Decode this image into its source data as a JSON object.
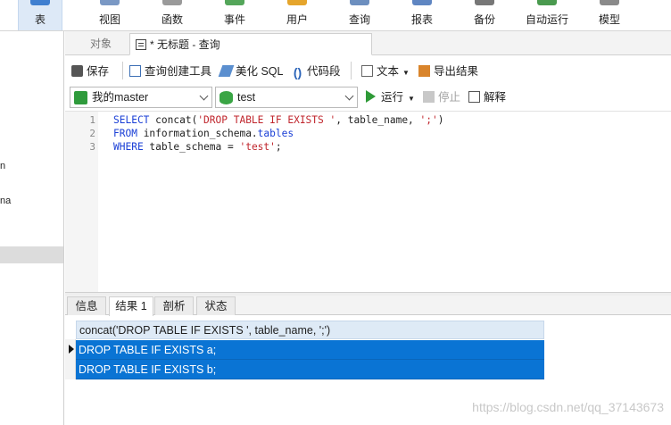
{
  "ribbon": {
    "items": [
      {
        "label": "表",
        "icon": "table-icon",
        "active": true
      },
      {
        "label": "视图",
        "icon": "view-icon"
      },
      {
        "label": "函数",
        "icon": "function-icon"
      },
      {
        "label": "事件",
        "icon": "event-icon"
      },
      {
        "label": "用户",
        "icon": "user-icon"
      },
      {
        "label": "查询",
        "icon": "query-icon"
      },
      {
        "label": "报表",
        "icon": "report-icon"
      },
      {
        "label": "备份",
        "icon": "backup-icon"
      },
      {
        "label": "自动运行",
        "icon": "automation-icon"
      },
      {
        "label": "模型",
        "icon": "model-icon"
      }
    ]
  },
  "leftpane": {
    "frag1": "n",
    "frag2": "na"
  },
  "tabs": {
    "objects": "对象",
    "query": "* 无标题 - 查询"
  },
  "toolbar": {
    "save": "保存",
    "query_builder": "查询创建工具",
    "beautify": "美化 SQL",
    "snippet": "代码段",
    "text": "文本",
    "export": "导出结果"
  },
  "connection": {
    "server": "我的master",
    "database": "test",
    "run": "运行",
    "stop": "停止",
    "explain": "解释"
  },
  "editor": {
    "line_numbers": [
      "1",
      "2",
      "3"
    ],
    "line1": {
      "kw1": "SELECT",
      "t1": " concat(",
      "s1": "'DROP TABLE IF EXISTS '",
      "t2": ", table_name, ",
      "s2": "';'",
      "t3": ")"
    },
    "line2": {
      "kw1": "FROM",
      "t1": " information_schema.",
      "kw2": "tables"
    },
    "line3": {
      "kw1": "WHERE",
      "t1": " table_schema = ",
      "s1": "'test'",
      "t2": ";"
    }
  },
  "results": {
    "tabs": [
      "信息",
      "结果 1",
      "剖析",
      "状态"
    ],
    "active_tab": "结果 1",
    "column": "concat('DROP TABLE IF EXISTS ', table_name, ';')",
    "rows": [
      "DROP TABLE IF EXISTS a;",
      "DROP TABLE IF EXISTS b;"
    ]
  },
  "watermark": "https://blog.csdn.net/qq_37143673",
  "colors": {
    "keyword": "#1a3fd6",
    "string": "#c0262d",
    "selection": "#0a74d4",
    "header": "#deeaf6"
  }
}
